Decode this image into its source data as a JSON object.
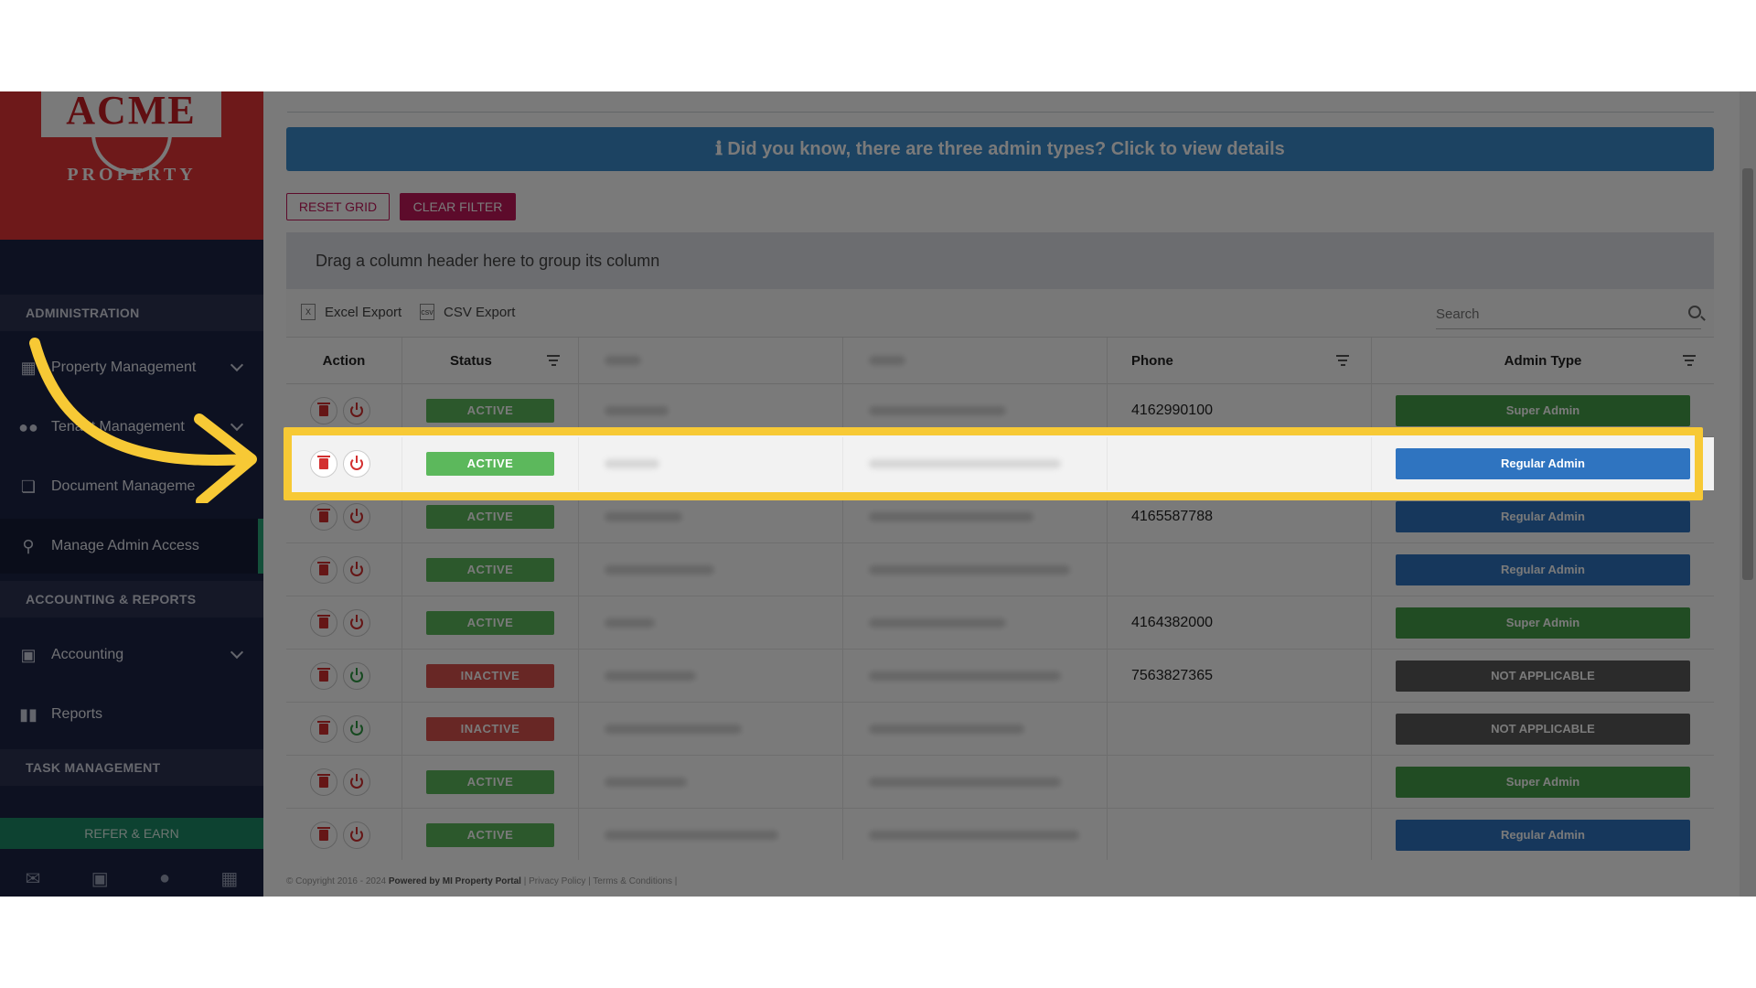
{
  "sidebar": {
    "logo_text": "ACME",
    "logo_sub": "PROPERTY",
    "sections": {
      "administration": "ADMINISTRATION",
      "accounting_reports": "ACCOUNTING & REPORTS",
      "task_management": "TASK MANAGEMENT"
    },
    "items": {
      "property_management": "Property Management",
      "tenant_management": "Tenant Management",
      "document_management": "Document Manageme",
      "manage_admin_access": "Manage Admin Access",
      "accounting": "Accounting",
      "reports": "Reports"
    },
    "refer_earn": "REFER & EARN"
  },
  "main": {
    "banner": "ℹ Did you know, there are three admin types? Click to view details",
    "reset_grid": "RESET GRID",
    "clear_filter": "CLEAR FILTER",
    "group_hint": "Drag a column header here to group its column",
    "excel_export": "Excel Export",
    "csv_export": "CSV Export",
    "search_placeholder": "Search"
  },
  "grid": {
    "columns": {
      "action": "Action",
      "status": "Status",
      "phone": "Phone",
      "admin_type": "Admin Type"
    },
    "rows": [
      {
        "status": "ACTIVE",
        "phone": "4162990100",
        "admin_type": "Super Admin"
      },
      {
        "status": "ACTIVE",
        "phone": "",
        "admin_type": "Regular Admin"
      },
      {
        "status": "ACTIVE",
        "phone": "4165587788",
        "admin_type": "Regular Admin"
      },
      {
        "status": "ACTIVE",
        "phone": "",
        "admin_type": "Regular Admin"
      },
      {
        "status": "ACTIVE",
        "phone": "4164382000",
        "admin_type": "Super Admin"
      },
      {
        "status": "INACTIVE",
        "phone": "7563827365",
        "admin_type": "NOT APPLICABLE"
      },
      {
        "status": "INACTIVE",
        "phone": "",
        "admin_type": "NOT APPLICABLE"
      },
      {
        "status": "ACTIVE",
        "phone": "",
        "admin_type": "Super Admin"
      },
      {
        "status": "ACTIVE",
        "phone": "",
        "admin_type": "Regular Admin"
      }
    ]
  },
  "footer": {
    "copyright": "© Copyright 2016 - 2024",
    "powered": "Powered by MI Property Portal",
    "links": "| Privacy Policy | Terms & Conditions |"
  },
  "colors": {
    "active": "#5cb85c",
    "inactive": "#d9534f",
    "super_admin": "#46a049",
    "regular_admin": "#2f74c0",
    "not_applicable": "#5a5a5a",
    "highlight": "#f7c935"
  }
}
